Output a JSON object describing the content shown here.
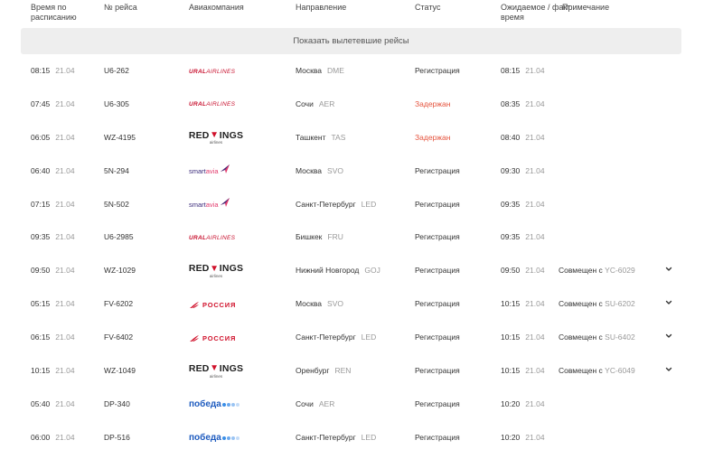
{
  "headers": {
    "scheduled": "Время по расписанию",
    "flight": "№ рейса",
    "airline": "Авиакомпания",
    "destination": "Направление",
    "status": "Статус",
    "expected": "Ожидаемое / факт. время",
    "note": "Примечание"
  },
  "show_departed_label": "Показать вылетевшие рейсы",
  "colors": {
    "delayed": "#e5533d",
    "band": "#eeeeee"
  },
  "flights": [
    {
      "sched_time": "08:15",
      "sched_date": "21.04",
      "flight": "U6-262",
      "airline": "ural",
      "city": "Москва",
      "code": "DME",
      "status": "Регистрация",
      "exp_time": "08:15",
      "exp_date": "21.04",
      "note": "",
      "note_code": ""
    },
    {
      "sched_time": "07:45",
      "sched_date": "21.04",
      "flight": "U6-305",
      "airline": "ural",
      "city": "Сочи",
      "code": "AER",
      "status": "Задержан",
      "exp_time": "08:35",
      "exp_date": "21.04",
      "note": "",
      "note_code": ""
    },
    {
      "sched_time": "06:05",
      "sched_date": "21.04",
      "flight": "WZ-4195",
      "airline": "redwings",
      "city": "Ташкент",
      "code": "TAS",
      "status": "Задержан",
      "exp_time": "08:40",
      "exp_date": "21.04",
      "note": "",
      "note_code": ""
    },
    {
      "sched_time": "06:40",
      "sched_date": "21.04",
      "flight": "5N-294",
      "airline": "smartavia",
      "city": "Москва",
      "code": "SVO",
      "status": "Регистрация",
      "exp_time": "09:30",
      "exp_date": "21.04",
      "note": "",
      "note_code": ""
    },
    {
      "sched_time": "07:15",
      "sched_date": "21.04",
      "flight": "5N-502",
      "airline": "smartavia",
      "city": "Санкт-Петербург",
      "code": "LED",
      "status": "Регистрация",
      "exp_time": "09:35",
      "exp_date": "21.04",
      "note": "",
      "note_code": ""
    },
    {
      "sched_time": "09:35",
      "sched_date": "21.04",
      "flight": "U6-2985",
      "airline": "ural",
      "city": "Бишкек",
      "code": "FRU",
      "status": "Регистрация",
      "exp_time": "09:35",
      "exp_date": "21.04",
      "note": "",
      "note_code": ""
    },
    {
      "sched_time": "09:50",
      "sched_date": "21.04",
      "flight": "WZ-1029",
      "airline": "redwings",
      "city": "Нижний Новгород",
      "code": "GOJ",
      "status": "Регистрация",
      "exp_time": "09:50",
      "exp_date": "21.04",
      "note": "Совмещен с",
      "note_code": "YC-6029"
    },
    {
      "sched_time": "05:15",
      "sched_date": "21.04",
      "flight": "FV-6202",
      "airline": "rossiya",
      "city": "Москва",
      "code": "SVO",
      "status": "Регистрация",
      "exp_time": "10:15",
      "exp_date": "21.04",
      "note": "Совмещен с",
      "note_code": "SU-6202"
    },
    {
      "sched_time": "06:15",
      "sched_date": "21.04",
      "flight": "FV-6402",
      "airline": "rossiya",
      "city": "Санкт-Петербург",
      "code": "LED",
      "status": "Регистрация",
      "exp_time": "10:15",
      "exp_date": "21.04",
      "note": "Совмещен с",
      "note_code": "SU-6402"
    },
    {
      "sched_time": "10:15",
      "sched_date": "21.04",
      "flight": "WZ-1049",
      "airline": "redwings",
      "city": "Оренбург",
      "code": "REN",
      "status": "Регистрация",
      "exp_time": "10:15",
      "exp_date": "21.04",
      "note": "Совмещен с",
      "note_code": "YC-6049"
    },
    {
      "sched_time": "05:40",
      "sched_date": "21.04",
      "flight": "DP-340",
      "airline": "pobeda",
      "city": "Сочи",
      "code": "AER",
      "status": "Регистрация",
      "exp_time": "10:20",
      "exp_date": "21.04",
      "note": "",
      "note_code": ""
    },
    {
      "sched_time": "06:00",
      "sched_date": "21.04",
      "flight": "DP-516",
      "airline": "pobeda",
      "city": "Санкт-Петербург",
      "code": "LED",
      "status": "Регистрация",
      "exp_time": "10:20",
      "exp_date": "21.04",
      "note": "",
      "note_code": ""
    }
  ],
  "logos": {
    "ural": {
      "main": "URAL",
      "rest": "AIRLINES",
      "icon": "ural-airlines-logo"
    },
    "redwings": {
      "a": "RED",
      "b": "INGS",
      "sub": "airlines",
      "icon": "red-wings-logo"
    },
    "smartavia": {
      "a": "smart",
      "b": "avia",
      "icon": "smartavia-logo"
    },
    "rossiya": {
      "text": "РОССИЯ",
      "icon": "rossiya-logo"
    },
    "pobeda": {
      "text": "победа",
      "icon": "pobeda-logo"
    }
  }
}
